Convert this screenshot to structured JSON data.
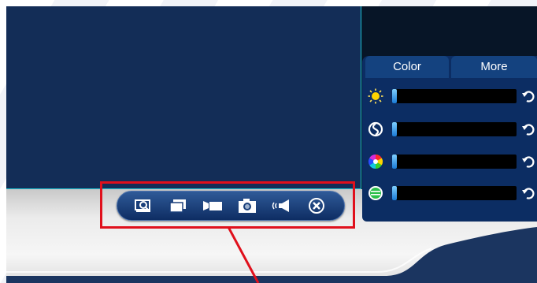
{
  "panel": {
    "tabs": [
      {
        "label": "Color",
        "active": true
      },
      {
        "label": "More",
        "active": false
      }
    ],
    "sliders": [
      {
        "name": "brightness",
        "icon": "sun-icon",
        "value": 0
      },
      {
        "name": "contrast",
        "icon": "contrast-icon",
        "value": 0
      },
      {
        "name": "saturation",
        "icon": "color-wheel-icon",
        "value": 0
      },
      {
        "name": "hue",
        "icon": "hue-icon",
        "value": 0
      }
    ]
  },
  "toolbar": {
    "buttons": [
      {
        "name": "zoom-button",
        "icon": "zoom-preview-icon"
      },
      {
        "name": "fullscreen-button",
        "icon": "windows-icon"
      },
      {
        "name": "record-button",
        "icon": "video-camera-icon"
      },
      {
        "name": "snapshot-button",
        "icon": "camera-icon"
      },
      {
        "name": "audio-button",
        "icon": "speaker-icon"
      },
      {
        "name": "close-video-button",
        "icon": "close-circle-icon"
      }
    ]
  },
  "colors": {
    "video_bg": "#132d57",
    "panel_bg": "#0c2d63",
    "highlight": "#e0101c",
    "toolbar_bg": "#1a3f7a"
  }
}
